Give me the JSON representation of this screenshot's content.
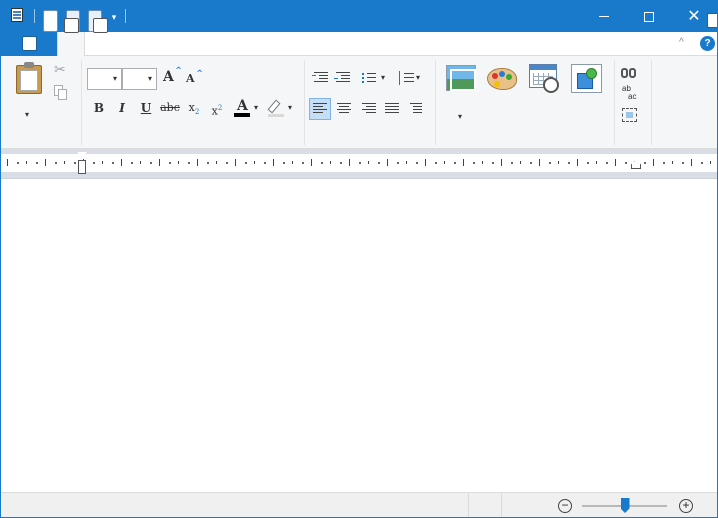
{
  "window": {
    "title": "",
    "controls": [
      "minimize-icon",
      "maximize-icon",
      "close-icon"
    ],
    "close_glyph": "✕"
  },
  "quick_access": {
    "more_glyph": "▾"
  },
  "ribbon": {
    "collapse_glyph": "^",
    "help_glyph": "?",
    "clipboard": {
      "cut_glyph": "✂",
      "dropdown_glyph": "▾"
    },
    "font": {
      "family_value": "",
      "size_value": "",
      "dropdown_glyph": "▾",
      "grow_label": "A",
      "shrink_label": "A",
      "bold_label": "B",
      "italic_label": "I",
      "underline_label": "U",
      "strikethrough_label": "abc",
      "subscript_base": "x",
      "subscript_mark": "2",
      "superscript_base": "x",
      "superscript_mark": "2",
      "font_color_label": "A"
    },
    "paragraph": {
      "align_left_selected": true
    },
    "editing": {
      "replace_label_top": "ab",
      "replace_label_bottom": "ac"
    }
  },
  "colors": {
    "accent": "#1979ca",
    "ribbon_bg": "#f5f6f7",
    "ruler_band": "#d9dee6",
    "status_bg": "#f0f0f0",
    "font_color_bar": "#000000"
  },
  "statusbar": {
    "zoom_out_glyph": "−",
    "zoom_in_glyph": "+",
    "zoom_level": 0.5
  }
}
